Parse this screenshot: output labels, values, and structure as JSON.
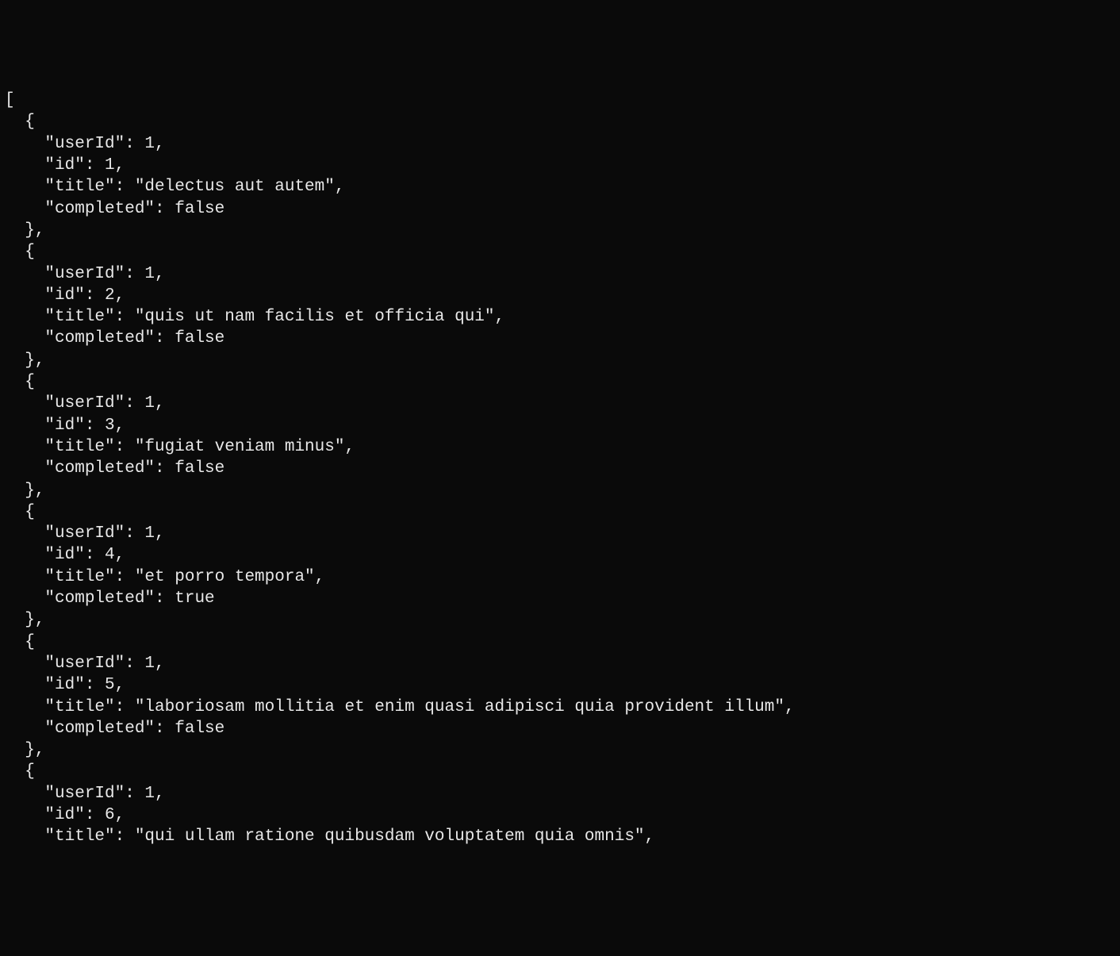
{
  "records": [
    {
      "userId": 1,
      "id": 1,
      "title": "delectus aut autem",
      "completed": false
    },
    {
      "userId": 1,
      "id": 2,
      "title": "quis ut nam facilis et officia qui",
      "completed": false
    },
    {
      "userId": 1,
      "id": 3,
      "title": "fugiat veniam minus",
      "completed": false
    },
    {
      "userId": 1,
      "id": 4,
      "title": "et porro tempora",
      "completed": true
    },
    {
      "userId": 1,
      "id": 5,
      "title": "laboriosam mollitia et enim quasi adipisci quia provident illum",
      "completed": false
    },
    {
      "userId": 1,
      "id": 6,
      "title": "qui ullam ratione quibusdam voluptatem quia omnis",
      "completed": null
    }
  ],
  "keys": {
    "userId": "userId",
    "id": "id",
    "title": "title",
    "completed": "completed"
  },
  "truncated_last": true
}
